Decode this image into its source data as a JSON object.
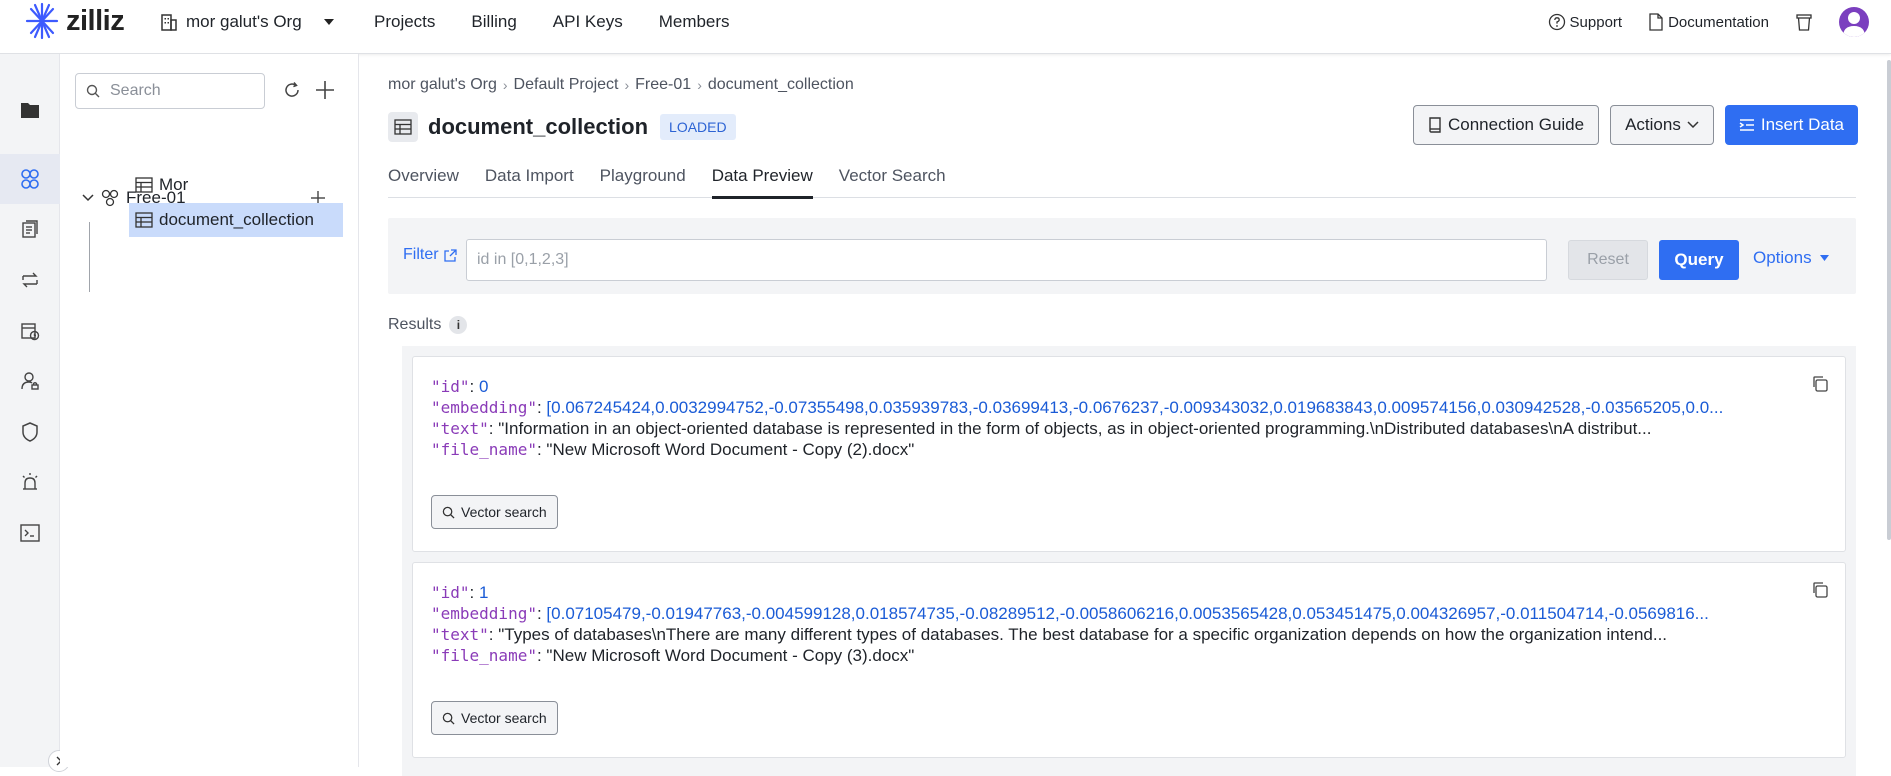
{
  "brand": {
    "name": "zilliz"
  },
  "org": {
    "name": "mor galut's Org"
  },
  "topnav": [
    "Projects",
    "Billing",
    "API Keys",
    "Members"
  ],
  "topright": {
    "support": "Support",
    "documentation": "Documentation"
  },
  "tree": {
    "search_placeholder": "Search",
    "cluster": "Free-01",
    "collections": [
      "Mor",
      "document_collection"
    ]
  },
  "breadcrumb": [
    "mor galut's Org",
    "Default Project",
    "Free-01",
    "document_collection"
  ],
  "collection": {
    "name": "document_collection",
    "status": "LOADED"
  },
  "header_buttons": {
    "connection_guide": "Connection Guide",
    "actions": "Actions",
    "insert_data": "Insert Data"
  },
  "tabs": [
    "Overview",
    "Data Import",
    "Playground",
    "Data Preview",
    "Vector Search"
  ],
  "active_tab": "Data Preview",
  "filter": {
    "label": "Filter",
    "placeholder": "id in [0,1,2,3]",
    "reset": "Reset",
    "query": "Query",
    "options": "Options"
  },
  "results": {
    "label": "Results",
    "info": "i",
    "vector_search_label": "Vector search",
    "records": [
      {
        "id": "0",
        "embedding": "[0.067245424,0.0032994752,-0.07355498,0.035939783,-0.03699413,-0.0676237,-0.009343032,0.019683843,0.009574156,0.030942528,-0.03565205,0.0...",
        "text": "\"Information in an object-oriented database is represented in the form of objects, as in object-oriented programming.\\nDistributed databases\\nA distribut...",
        "file_name": "\"New Microsoft Word Document - Copy (2).docx\""
      },
      {
        "id": "1",
        "embedding": "[0.07105479,-0.01947763,-0.004599128,0.018574735,-0.08289512,-0.0058606216,0.0053565428,0.053451475,0.004326957,-0.011504714,-0.0569816...",
        "text": "\"Types of databases\\nThere are many different types of databases. The best database for a specific organization depends on how the organization intend...",
        "file_name": "\"New Microsoft Word Document - Copy (3).docx\""
      }
    ]
  },
  "keys": {
    "id": "\"id\"",
    "embedding": "\"embedding\"",
    "text": "\"text\"",
    "file_name": "\"file_name\""
  },
  "colors": {
    "accent": "#2f6ef2",
    "json_key": "#8a3bb8",
    "number": "#1a5bd6",
    "selected_row": "#c9dbfb"
  }
}
